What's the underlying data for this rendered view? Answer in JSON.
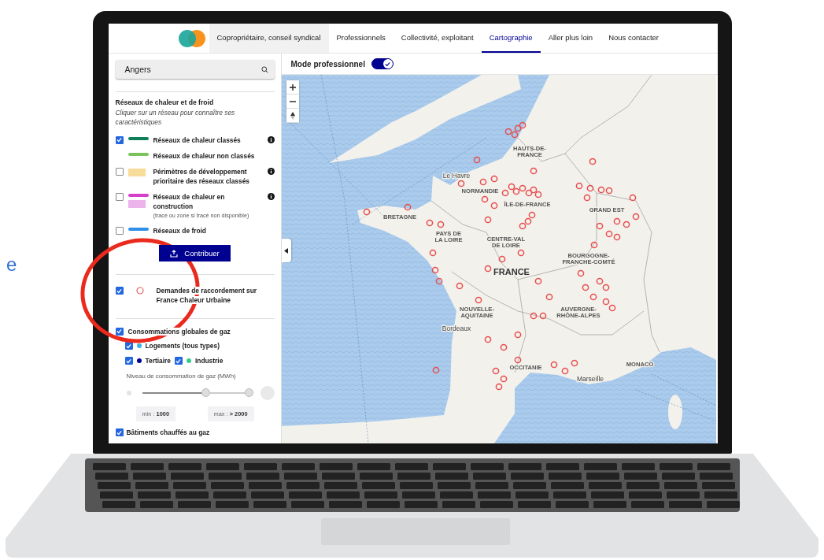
{
  "side_text": "e",
  "nav": {
    "items": [
      {
        "label": "Copropriétaire, conseil syndical",
        "selected": false,
        "highlighted": true
      },
      {
        "label": "Professionnels",
        "selected": false,
        "highlighted": false
      },
      {
        "label": "Collectivité, exploitant",
        "selected": false,
        "highlighted": false
      },
      {
        "label": "Cartographie",
        "selected": true,
        "highlighted": false
      },
      {
        "label": "Aller plus loin",
        "selected": false,
        "highlighted": false
      },
      {
        "label": "Nous contacter",
        "selected": false,
        "highlighted": false
      }
    ]
  },
  "search": {
    "value": "Angers"
  },
  "layers_section": {
    "title": "Réseaux de chaleur et de froid",
    "hint": "Cliquer sur un réseau pour connaître ses caractéristiques",
    "layers": [
      {
        "label": "Réseaux de chaleur classés",
        "checked": true,
        "info": true,
        "swatches": [
          {
            "kind": "line",
            "color": "#0f7f5a"
          }
        ]
      },
      {
        "label": "Réseaux de chaleur non classés",
        "info": false,
        "swatches": [
          {
            "kind": "line",
            "color": "#79c35a"
          }
        ]
      },
      {
        "label": "Périmètres de développement prioritaire des réseaux classés",
        "checked": false,
        "info": true,
        "swatches": [
          {
            "kind": "area",
            "color": "#f7dc9c"
          }
        ]
      },
      {
        "label": "Réseaux de chaleur en construction",
        "subnote": "(tracé ou zone si tracé non disponible)",
        "checked": false,
        "info": true,
        "swatches": [
          {
            "kind": "line",
            "color": "#d63fc9"
          },
          {
            "kind": "area",
            "color": "#ecb3ec"
          }
        ]
      },
      {
        "label": "Réseaux de froid",
        "checked": false,
        "info": false,
        "swatches": [
          {
            "kind": "line",
            "color": "#2f8fe6"
          }
        ]
      }
    ]
  },
  "contribute_button": {
    "label": "Contribuer"
  },
  "requests": {
    "label": "Demandes de raccordement sur France Chaleur Urbaine",
    "checked": true
  },
  "gas": {
    "label": "Consommations globales de gaz",
    "checked": true,
    "types": [
      {
        "label": "Logements (tous types)",
        "checked": true,
        "color": "#3bb0e8"
      },
      {
        "label": "Tertiaire",
        "checked": true,
        "color": "#000091"
      },
      {
        "label": "Industrie",
        "checked": true,
        "color": "#34cb8f"
      }
    ],
    "level_label": "Niveau de consommation de gaz (MWh)",
    "slider": {
      "thumbs": [
        {
          "level": 0.6
        },
        {
          "level": 1
        }
      ]
    },
    "min": "min : **1000**",
    "max": "max : **> 2000**"
  },
  "gas_buildings": {
    "label": "Bâtiments chauffés au gaz",
    "checked": true
  },
  "mode": {
    "label": "Mode professionnel",
    "on": true
  },
  "map": {
    "labels": [
      {
        "kind": "city",
        "lines": [
          "Le Havre"
        ]
      },
      {
        "kind": "region",
        "lines": [
          "HAUTS-DE-",
          "FRANCE"
        ]
      },
      {
        "kind": "region",
        "lines": [
          "NORMANDIE"
        ]
      },
      {
        "kind": "region",
        "lines": [
          "BRETAGNE"
        ]
      },
      {
        "kind": "region",
        "lines": [
          "PAYS DE",
          "LA LOIRE"
        ]
      },
      {
        "kind": "region",
        "lines": [
          "CENTRE-VAL",
          "DE LOIRE"
        ]
      },
      {
        "kind": "region",
        "lines": [
          "ÎLE-DE-FRANCE"
        ]
      },
      {
        "kind": "region",
        "lines": [
          "GRAND EST"
        ]
      },
      {
        "kind": "region",
        "lines": [
          "BOURGOGNE-",
          "FRANCHE-COMTÉ"
        ]
      },
      {
        "kind": "country",
        "lines": [
          "FRANCE"
        ]
      },
      {
        "kind": "region",
        "lines": [
          "NOUVELLE-",
          "AQUITAINE"
        ]
      },
      {
        "kind": "region",
        "lines": [
          "AUVERGNE-",
          "RHÔNE-ALPES"
        ]
      },
      {
        "kind": "city",
        "lines": [
          "Bordeaux"
        ]
      },
      {
        "kind": "region",
        "lines": [
          "OCCITANIE"
        ]
      },
      {
        "kind": "city",
        "lines": [
          "Marseille"
        ]
      },
      {
        "kind": "region",
        "lines": [
          "MONACO"
        ]
      }
    ]
  }
}
